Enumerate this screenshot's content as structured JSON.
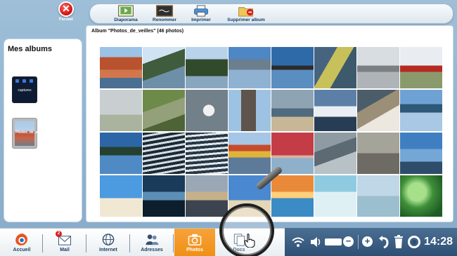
{
  "window": {
    "close_label": "Fermer"
  },
  "toolbar": {
    "items": [
      {
        "label": "Diaporama",
        "icon": "slideshow-icon"
      },
      {
        "label": "Renommer",
        "icon": "rename-board-icon"
      },
      {
        "label": "Imprimer",
        "icon": "printer-icon"
      },
      {
        "label": "Supprimer album",
        "icon": "delete-folder-icon"
      }
    ]
  },
  "sidebar": {
    "title": "Mes albums",
    "albums": [
      {
        "label": "captures"
      },
      {
        "label": "Photos_de_veil"
      }
    ]
  },
  "album": {
    "header": "Album \"Photos_de_veilles\" (46 photos)",
    "photos": [
      "houses-town",
      "fjord-mountains",
      "fjord-valley",
      "mountain-lake",
      "coast-blue",
      "cliff-sea",
      "cloudy-fjord",
      "red-cabin",
      "grey-sky",
      "moss-rocks",
      "seagull",
      "stone-tower",
      "coast-horizon",
      "snow-shore",
      "rock-shore",
      "lake-mountains",
      "blue-fjord",
      "water-ripples",
      "water-ripples-2",
      "red-houses",
      "red-building",
      "grey-rocks",
      "rock-bird",
      "dock-boat",
      "palm-beach",
      "palm-sunset",
      "cloud-sunset",
      "beach-sign",
      "pier-sunset",
      "frozen-lake",
      "bird-shore",
      "green-leaves"
    ]
  },
  "taskbar": {
    "items": [
      {
        "label": "Accueil",
        "icon": "home-logo-icon"
      },
      {
        "label": "Mail",
        "icon": "mail-icon",
        "badge": "2"
      },
      {
        "label": "Internet",
        "icon": "globe-icon"
      },
      {
        "label": "Adresses",
        "icon": "contacts-icon"
      },
      {
        "label": "Photos",
        "icon": "camera-icon"
      },
      {
        "label": "Docs",
        "icon": "documents-icon"
      }
    ]
  },
  "tray": {
    "time": "14:28"
  },
  "colors": {
    "accent": "#ef8f14",
    "tray": "#2d4f73",
    "close": "#d81818"
  }
}
